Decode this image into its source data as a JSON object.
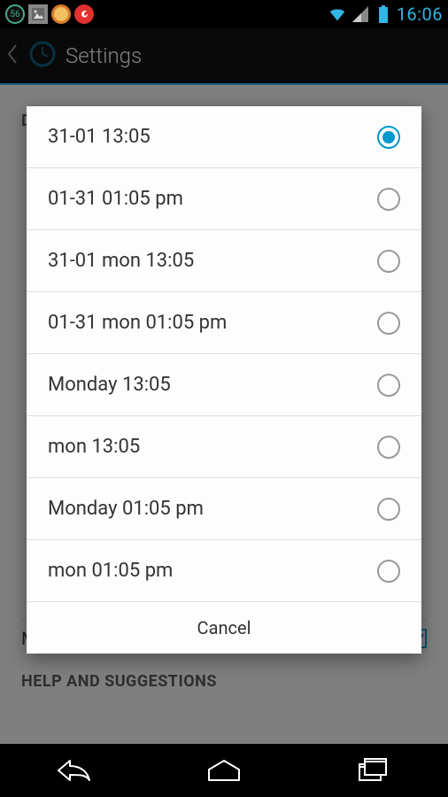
{
  "status": {
    "badge": "56",
    "time": "16:06"
  },
  "actionbar": {
    "title": "Settings"
  },
  "bg": {
    "section1": "DATE FORMAT",
    "missed": "Missed Calls",
    "help": "HELP AND SUGGESTIONS"
  },
  "dialog": {
    "options": [
      {
        "label": "31-01 13:05",
        "selected": true
      },
      {
        "label": "01-31 01:05 pm",
        "selected": false
      },
      {
        "label": "31-01 mon 13:05",
        "selected": false
      },
      {
        "label": "01-31 mon 01:05 pm",
        "selected": false
      },
      {
        "label": "Monday 13:05",
        "selected": false
      },
      {
        "label": "mon 13:05",
        "selected": false
      },
      {
        "label": "Monday 01:05 pm",
        "selected": false
      },
      {
        "label": "mon 01:05 pm",
        "selected": false
      }
    ],
    "cancel": "Cancel"
  }
}
